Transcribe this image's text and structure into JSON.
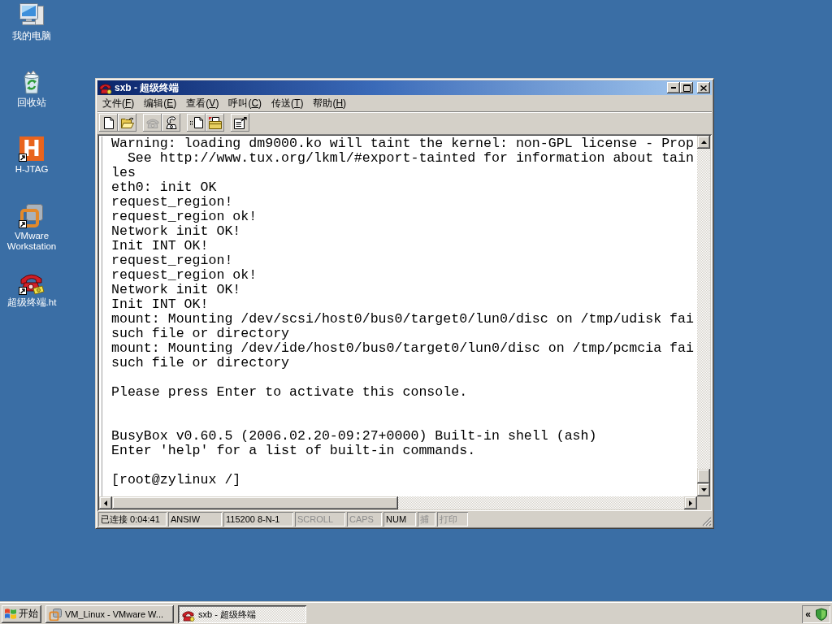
{
  "desktop_icons": [
    {
      "kind": "computer",
      "label": "我的电脑",
      "shortcut": false
    },
    {
      "kind": "recycle_bin",
      "label": "回收站",
      "shortcut": false
    },
    {
      "kind": "logo",
      "logo_letter": "H",
      "label": "H-JTAG",
      "shortcut": true
    },
    {
      "kind": "vmware",
      "label": "VMware Workstation",
      "shortcut": true
    },
    {
      "kind": "telephone",
      "label": "超级终端.ht",
      "shortcut": true
    }
  ],
  "window": {
    "title": "sxb - 超级终端",
    "active": true,
    "menu": [
      "文件(F)",
      "编辑(E)",
      "查看(V)",
      "呼叫(C)",
      "传送(T)",
      "帮助(H)"
    ],
    "toolbar": [
      {
        "buttons": [
          {
            "kind": "new",
            "disabled": false
          },
          {
            "kind": "open",
            "disabled": false
          }
        ]
      },
      {
        "buttons": [
          {
            "kind": "call",
            "disabled": true
          },
          {
            "kind": "hangup",
            "disabled": false
          }
        ]
      },
      {
        "buttons": [
          {
            "kind": "send",
            "disabled": false
          },
          {
            "kind": "receive",
            "disabled": false
          }
        ]
      },
      {
        "buttons": [
          {
            "kind": "properties",
            "disabled": false
          }
        ]
      }
    ],
    "terminal": {
      "lines": [
        {
          "kind": "text",
          "text": "Warning: loading dm9000.ko will taint the kernel: non-GPL license - Prop"
        },
        {
          "kind": "text",
          "text": "  See http://www.tux.org/lkml/#export-tainted for information about tain"
        },
        {
          "kind": "text",
          "text": "les"
        },
        {
          "kind": "text",
          "text": "eth0: init OK"
        },
        {
          "kind": "text",
          "text": "request_region!"
        },
        {
          "kind": "text",
          "text": "request_region ok!"
        },
        {
          "kind": "text",
          "text": "Network init OK!"
        },
        {
          "kind": "text",
          "text": "Init INT OK!"
        },
        {
          "kind": "text",
          "text": "request_region!"
        },
        {
          "kind": "text",
          "text": "request_region ok!"
        },
        {
          "kind": "text",
          "text": "Network init OK!"
        },
        {
          "kind": "text",
          "text": "Init INT OK!"
        },
        {
          "kind": "text",
          "text": "mount: Mounting /dev/scsi/host0/bus0/target0/lun0/disc on /tmp/udisk fai"
        },
        {
          "kind": "text",
          "text": "such file or directory"
        },
        {
          "kind": "text",
          "text": "mount: Mounting /dev/ide/host0/bus0/target0/lun0/disc on /tmp/pcmcia fai"
        },
        {
          "kind": "text",
          "text": "such file or directory"
        },
        {
          "kind": "blank"
        },
        {
          "kind": "text",
          "text": "Please press Enter to activate this console."
        },
        {
          "kind": "blank"
        },
        {
          "kind": "blank"
        },
        {
          "kind": "text",
          "text": "BusyBox v0.60.5 (2006.02.20-09:27+0000) Built-in shell (ash)"
        },
        {
          "kind": "text",
          "text": "Enter 'help' for a list of built-in commands."
        },
        {
          "kind": "blank"
        },
        {
          "kind": "text",
          "text": "[root@zylinux /]"
        }
      ]
    },
    "status_bar": [
      {
        "text": "已连接 0:04:41",
        "disabled": false
      },
      {
        "text": "ANSIW",
        "disabled": false
      },
      {
        "text": "115200 8-N-1",
        "disabled": false
      },
      {
        "text": "SCROLL",
        "disabled": true
      },
      {
        "text": "CAPS",
        "disabled": true
      },
      {
        "text": "NUM",
        "disabled": false
      },
      {
        "text": "捕",
        "disabled": true
      },
      {
        "text": "打印",
        "disabled": true
      }
    ]
  },
  "taskbar": {
    "start": "开始",
    "tasks": [
      {
        "kind": "vmware",
        "label": "VM_Linux - VMware W...",
        "selected": false
      },
      {
        "kind": "telephone",
        "label": "sxb - 超级终端",
        "selected": true
      }
    ],
    "tray": {
      "expand": "«"
    }
  }
}
